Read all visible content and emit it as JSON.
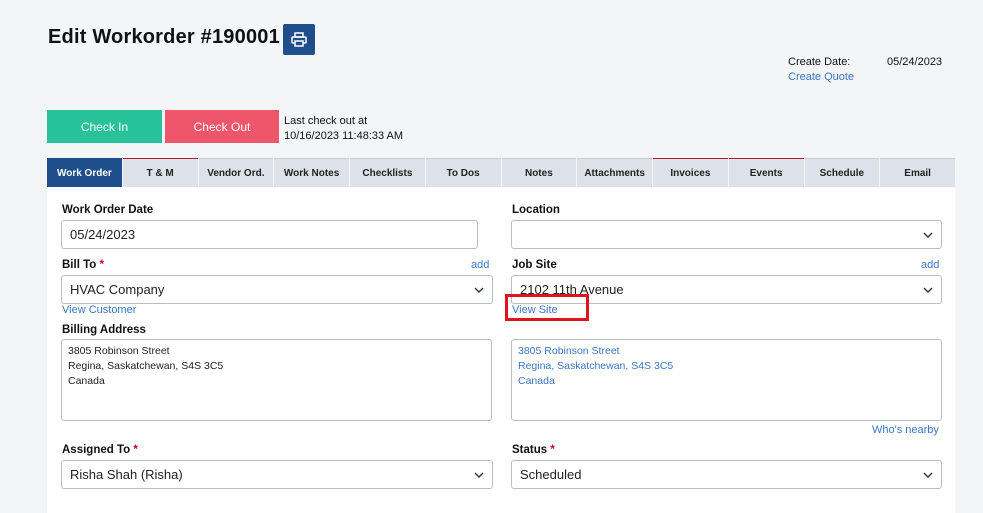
{
  "header": {
    "title": "Edit Workorder #190001",
    "create_date_label": "Create Date:",
    "create_date_value": "05/24/2023",
    "create_quote_link": "Create Quote"
  },
  "actions": {
    "check_in": "Check In",
    "check_out": "Check Out",
    "last_checkout_line1": "Last check out at",
    "last_checkout_line2": "10/16/2023 11:48:33 AM"
  },
  "tabs": [
    {
      "label": "Work Order",
      "active": true
    },
    {
      "label": "T & M",
      "red": true
    },
    {
      "label": "Vendor Ord."
    },
    {
      "label": "Work Notes"
    },
    {
      "label": "Checklists"
    },
    {
      "label": "To Dos"
    },
    {
      "label": "Notes"
    },
    {
      "label": "Attachments"
    },
    {
      "label": "Invoices",
      "red": true
    },
    {
      "label": "Events",
      "red": true
    },
    {
      "label": "Schedule"
    },
    {
      "label": "Email"
    }
  ],
  "form": {
    "work_order_date_label": "Work Order Date",
    "work_order_date_value": "05/24/2023",
    "location_label": "Location",
    "location_value": "",
    "bill_to_label": "Bill To",
    "bill_to_value": "HVAC Company",
    "bill_to_add": "add",
    "view_customer": "View Customer",
    "job_site_label": "Job Site",
    "job_site_value": "2102 11th Avenue",
    "job_site_add": "add",
    "view_site": "View Site",
    "billing_address_label": "Billing Address",
    "billing_address_lines": [
      "3805 Robinson Street",
      "Regina, Saskatchewan, S4S 3C5",
      "Canada"
    ],
    "site_address_lines": [
      "3805 Robinson Street",
      "Regina, Saskatchewan, S4S 3C5",
      "Canada"
    ],
    "whos_nearby": "Who's nearby",
    "assigned_to_label": "Assigned To",
    "assigned_to_value": "Risha Shah (Risha)",
    "status_label": "Status",
    "status_value": "Scheduled",
    "required_mark": "*"
  },
  "colors": {
    "primary": "#1f4e8c",
    "check_in": "#27c19a",
    "check_out": "#f0566b",
    "link": "#3b76c4",
    "highlight": "#e0141e"
  }
}
